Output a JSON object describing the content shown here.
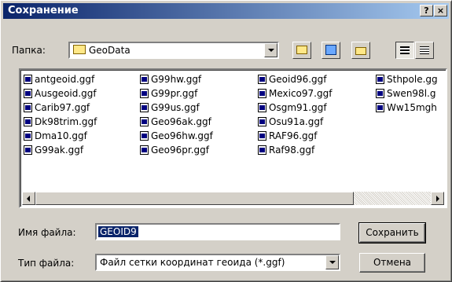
{
  "window": {
    "title": "Сохранение",
    "help_label": "?",
    "close_label": "×"
  },
  "folder": {
    "label": "Папка:",
    "value": "GeoData"
  },
  "toolbar": {
    "icons": [
      "up-folder-icon",
      "desktop-icon",
      "new-folder-icon",
      "list-view-icon",
      "details-view-icon"
    ]
  },
  "files": [
    "antgeoid.ggf",
    "Ausgeoid.ggf",
    "Carib97.ggf",
    "Dk98trim.ggf",
    "Dma10.ggf",
    "G99ak.ggf",
    "G99hw.ggf",
    "G99pr.ggf",
    "G99us.ggf",
    "Geo96ak.ggf",
    "Geo96hw.ggf",
    "Geo96pr.ggf",
    "Geoid96.ggf",
    "Mexico97.ggf",
    "Osgm91.ggf",
    "Osu91a.ggf",
    "RAF96.ggf",
    "Raf98.ggf",
    "Sthpole.gg",
    "Swen98l.g",
    "Ww15mgh"
  ],
  "filename": {
    "label": "Имя файла:",
    "value": "GEOID9"
  },
  "filetype": {
    "label": "Тип файла:",
    "value": "Файл сетки координат геоида (*.ggf)"
  },
  "buttons": {
    "save": "Сохранить",
    "cancel": "Отмена"
  }
}
